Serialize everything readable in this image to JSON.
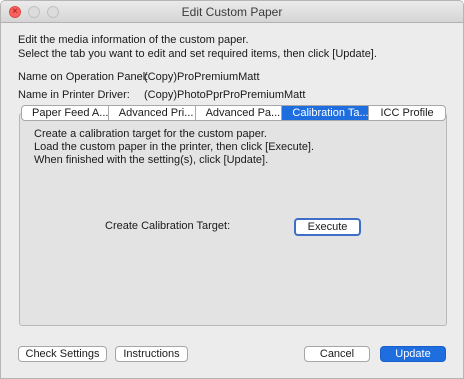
{
  "window": {
    "title": "Edit Custom Paper"
  },
  "intro": {
    "line1": "Edit the media information of the custom paper.",
    "line2": "Select the tab you want to edit and set required items, then click [Update]."
  },
  "names": {
    "operation_panel_label": "Name on Operation Panel:",
    "operation_panel_value": "(Copy)ProPremiumMatt",
    "printer_driver_label": "Name in Printer Driver:",
    "printer_driver_value": "(Copy)PhotoPprProPremiumMatt"
  },
  "tabs": [
    {
      "label": "Paper Feed A..."
    },
    {
      "label": "Advanced Pri..."
    },
    {
      "label": "Advanced Pa..."
    },
    {
      "label": "Calibration Ta...",
      "active": true
    },
    {
      "label": "ICC Profile"
    }
  ],
  "calibration": {
    "line1": "Create a calibration target for the custom paper.",
    "line2": "Load the custom paper in the printer, then click [Execute].",
    "line3": "When finished with the setting(s), click [Update].",
    "create_label": "Create Calibration Target:",
    "execute_label": "Execute"
  },
  "footer": {
    "check_settings": "Check Settings",
    "instructions": "Instructions",
    "cancel": "Cancel",
    "update": "Update"
  },
  "colors": {
    "accent": "#1f6ee0",
    "close_button": "#fc605c"
  },
  "icons": {
    "close": "close-icon",
    "minimize": "minimize-icon",
    "zoom": "zoom-icon"
  }
}
